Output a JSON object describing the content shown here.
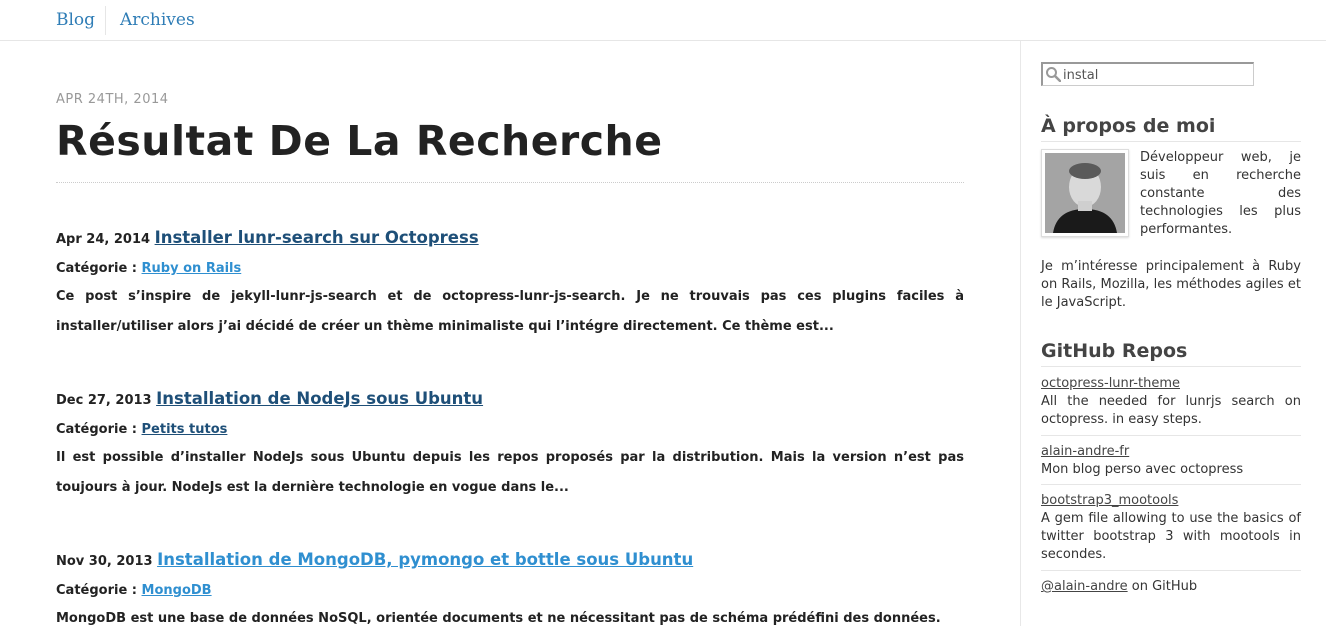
{
  "nav": {
    "blog": "Blog",
    "archives": "Archives"
  },
  "page": {
    "date": "Apr 24th, 2014",
    "title": "Résultat De La Recherche"
  },
  "results": [
    {
      "date": "Apr 24, 2014",
      "title": "Installer lunr-search sur Octopress",
      "category_label": "Catégorie :",
      "category": "Ruby on Rails",
      "excerpt": "Ce post s’inspire de jekyll-lunr-js-search et de octopress-lunr-js-search. Je ne trouvais pas ces plugins faciles à installer/utiliser alors j’ai décidé de créer un thème minimaliste qui l’intégre directement. Ce thème est..."
    },
    {
      "date": "Dec 27, 2013",
      "title": "Installation de NodeJs sous Ubuntu",
      "category_label": "Catégorie :",
      "category": "Petits tutos",
      "excerpt": "Il est possible d’installer NodeJs sous Ubuntu depuis les repos proposés par la distribution. Mais la version n’est pas toujours à jour. NodeJs est la dernière technologie en vogue dans le..."
    },
    {
      "date": "Nov 30, 2013",
      "title": "Installation de MongoDB, pymongo et bottle sous Ubuntu",
      "category_label": "Catégorie :",
      "category": "MongoDB",
      "excerpt": "MongoDB est une base de données NoSQL, orientée documents et ne nécessitant pas de schéma prédéfini des données."
    }
  ],
  "sidebar": {
    "search_value": "instal",
    "about_title": "À propos de moi",
    "about_text_1": "Développeur web, je suis en recherche constante des technologies les plus performantes.",
    "about_text_2": "Je m’intéresse principalement à Ruby on Rails, Mozilla, les méthodes agiles et le JavaScript.",
    "github_title": "GitHub Repos",
    "repos": [
      {
        "name": "octopress-lunr-theme",
        "desc": "All the needed for lunrjs search on octopress. in easy steps."
      },
      {
        "name": "alain-andre-fr",
        "desc": "Mon blog perso avec octopress"
      },
      {
        "name": "bootstrap3_mootools",
        "desc": "A gem file allowing to use the basics of twitter bootstrap 3 with mootools in secondes."
      }
    ],
    "github_user": "@alain-andre",
    "github_suffix": " on GitHub"
  },
  "colors": {
    "link_blue": "#2f8fd0",
    "link_dark": "#1e4f78",
    "nav_blue": "#2f7db6"
  }
}
